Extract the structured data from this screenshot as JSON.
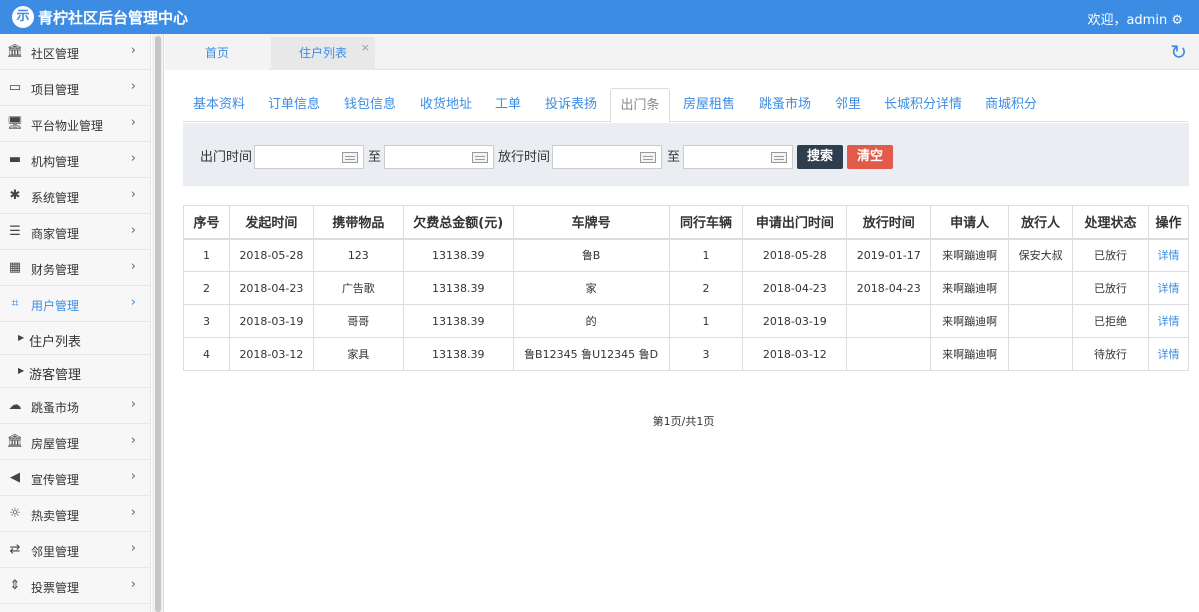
{
  "app": {
    "logo_glyph": "示",
    "title": "青柠社区后台管理中心",
    "welcome": "欢迎，admin ⚙"
  },
  "sidebar": {
    "items": [
      {
        "icon": "bank-icon",
        "glyph": "🏛",
        "label": "社区管理"
      },
      {
        "icon": "discover-card-icon",
        "glyph": "▭",
        "label": "项目管理"
      },
      {
        "icon": "monitor-icon",
        "glyph": "🖥",
        "label": "平台物业管理"
      },
      {
        "icon": "stripe-icon",
        "glyph": "▬",
        "label": "机构管理"
      },
      {
        "icon": "yelp-icon",
        "glyph": "✱",
        "label": "系统管理"
      },
      {
        "icon": "bars-icon",
        "glyph": "☰",
        "label": "商家管理"
      },
      {
        "icon": "calculator-icon",
        "glyph": "▦",
        "label": "财务管理"
      },
      {
        "icon": "crop-icon",
        "glyph": "⌗",
        "label": "用户管理",
        "active": true
      }
    ],
    "subitems": [
      {
        "label": "住户列表"
      },
      {
        "label": "游客管理"
      }
    ],
    "items2": [
      {
        "icon": "cloud-icon",
        "glyph": "☁",
        "label": "跳蚤市场"
      },
      {
        "icon": "bank-icon",
        "glyph": "🏛",
        "label": "房屋管理"
      },
      {
        "icon": "volume-icon",
        "glyph": "◀",
        "label": "宣传管理"
      },
      {
        "icon": "sun-icon",
        "glyph": "☼",
        "label": "热卖管理"
      },
      {
        "icon": "retweet-icon",
        "glyph": "⇄",
        "label": "邻里管理"
      },
      {
        "icon": "sort-icon",
        "glyph": "⇕",
        "label": "投票管理"
      }
    ],
    "arrow": "›"
  },
  "page_tabs": [
    {
      "label": "首页"
    },
    {
      "label": "住户列表",
      "close": "×"
    }
  ],
  "subtabs": [
    {
      "label": "基本资料"
    },
    {
      "label": "订单信息"
    },
    {
      "label": "钱包信息"
    },
    {
      "label": "收货地址"
    },
    {
      "label": "工单"
    },
    {
      "label": "投诉表扬"
    },
    {
      "label": "出门条",
      "active": true
    },
    {
      "label": "房屋租售"
    },
    {
      "label": "跳蚤市场"
    },
    {
      "label": "邻里"
    },
    {
      "label": "长城积分详情"
    },
    {
      "label": "商城积分"
    }
  ],
  "filter": {
    "exit_time": "出门时间",
    "to": "至",
    "release_time": "放行时间",
    "search": "搜索",
    "clear": "清空"
  },
  "table": {
    "headers": [
      "序号",
      "发起时间",
      "携带物品",
      "欠费总金额(元)",
      "车牌号",
      "同行车辆",
      "申请出门时间",
      "放行时间",
      "申请人",
      "放行人",
      "处理状态",
      "操作"
    ],
    "rows": [
      [
        "1",
        "2018-05-28",
        "123",
        "13138.39",
        "鲁B",
        "1",
        "2018-05-28",
        "2019-01-17",
        "来啊蹦迪啊",
        "保安大叔",
        "已放行",
        "详情"
      ],
      [
        "2",
        "2018-04-23",
        "广告歌",
        "13138.39",
        "家",
        "2",
        "2018-04-23",
        "2018-04-23",
        "来啊蹦迪啊",
        "",
        "已放行",
        "详情"
      ],
      [
        "3",
        "2018-03-19",
        "哥哥",
        "13138.39",
        "的",
        "1",
        "2018-03-19",
        "",
        "来啊蹦迪啊",
        "",
        "已拒绝",
        "详情"
      ],
      [
        "4",
        "2018-03-12",
        "家具",
        "13138.39",
        "鲁B12345 鲁U12345 鲁D",
        "3",
        "2018-03-12",
        "",
        "来啊蹦迪啊",
        "",
        "待放行",
        "详情"
      ]
    ]
  },
  "pager": "第1页/共1页",
  "colors": {
    "brand": "#3c8ce4",
    "search_btn": "#2f3e4e",
    "clear_btn": "#e25a4a"
  }
}
